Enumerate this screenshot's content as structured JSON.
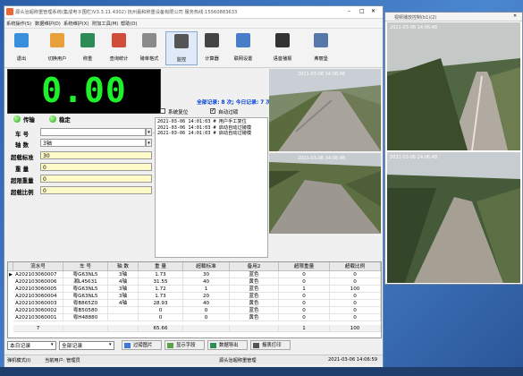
{
  "app": {
    "title": "源头治超称重管理系统(集成电子围栏)V3.3.11.4302)   抚州嘉和称重设备有限公司   服务热线:15560883633",
    "window_controls": [
      "–",
      "□",
      "✕"
    ]
  },
  "menu": [
    "系统操作(S)",
    "数据维护(D)",
    "系统维护(X)",
    "附加工具(M)",
    "帮助(O)"
  ],
  "toolbar": [
    {
      "label": "退出",
      "icon": "exit-icon",
      "color": "#3a8fdc"
    },
    {
      "label": "切换用户",
      "icon": "user-switch-icon",
      "color": "#e8a13a"
    },
    {
      "label": "称重",
      "icon": "scale-icon",
      "color": "#2d8b57"
    },
    {
      "label": "查询统计",
      "icon": "chart-icon",
      "color": "#d04b3a"
    },
    {
      "label": "磅单格式",
      "icon": "tools-icon",
      "color": "#8a8a8a"
    },
    {
      "label": "监控",
      "icon": "camera-icon",
      "color": "#555555"
    },
    {
      "label": "计算器",
      "icon": "calculator-icon",
      "color": "#444444"
    },
    {
      "label": "联网设置",
      "icon": "network-icon",
      "color": "#4a7ec9"
    },
    {
      "label": "语音播报",
      "icon": "microphone-icon",
      "color": "#333333"
    },
    {
      "label": "弗丽堡",
      "icon": "monitor-icon",
      "color": "#5577aa"
    }
  ],
  "weight_display": "0.00",
  "status_lights": {
    "transfer": "传输",
    "stable": "稳定"
  },
  "form": {
    "plate_label": "车 号",
    "plate_value": "",
    "axle_label": "轴 数",
    "axle_value": "3轴",
    "limit_label": "超载标准",
    "limit_value": "30",
    "weight_label": "重 量",
    "weight_value": "0",
    "over_label": "超限重量",
    "over_value": "0",
    "ratio_label": "超载比例",
    "ratio_value": "0"
  },
  "stats": "全部记录: 8 次; 今日记录: 7 次",
  "checkboxes": {
    "system_reset": "系统复位",
    "auto_save": "自动过磅"
  },
  "log_lines": [
    "2021-03-06 14:01:03 # 用户手工复位",
    "2021-03-06 14:01:03 # 启动自动过磅模",
    "2021-03-06 14:01:03 # 启动自动过磅模"
  ],
  "cam_stamps": [
    "2021-03-06 14:06:48",
    "2021-03-06 14:06:48"
  ],
  "table": {
    "headers": [
      "流水号",
      "车 号",
      "轴 数",
      "重 量",
      "超载标准",
      "备用2",
      "超限重量",
      "超载比例"
    ],
    "rows": [
      [
        "A202103060007",
        "粤G63NL5",
        "3轴",
        "1.73",
        "30",
        "蓝色",
        "0",
        "0"
      ],
      [
        "A202103060006",
        "湘L45631",
        "4轴",
        "31.55",
        "40",
        "黄色",
        "0",
        "0"
      ],
      [
        "A202103060005",
        "粤G63NL5",
        "3轴",
        "1.72",
        "1",
        "蓝色",
        "1",
        "100"
      ],
      [
        "A202103060004",
        "粤G63NL5",
        "3轴",
        "1.73",
        "20",
        "蓝色",
        "0",
        "0"
      ],
      [
        "A202103060003",
        "粤B865Z0",
        "4轴",
        "28.93",
        "40",
        "黄色",
        "0",
        "0"
      ],
      [
        "A202103060002",
        "粤B50580",
        "",
        "0",
        "0",
        "蓝色",
        "0",
        "0"
      ],
      [
        "A202103060001",
        "粤H48880",
        "",
        "0",
        "0",
        "黄色",
        "0",
        "0"
      ]
    ],
    "footer": [
      "7",
      "",
      "",
      "65.66",
      "",
      "",
      "1",
      "100"
    ]
  },
  "bottom": {
    "record_combo": "本日记录",
    "all_combo": "全部记录",
    "btn_photo": "过磅图片",
    "btn_display": "显示字段",
    "btn_export": "数据导出",
    "btn_print": "报表打印"
  },
  "statusbar": {
    "mode": "弹机模式(I)",
    "user": "当前用户: 管理员",
    "company": "源头治超称重管理",
    "time": "2021-03-06 14:06:59"
  },
  "video_window": {
    "title": "视频播放控制(b1)(2)"
  }
}
